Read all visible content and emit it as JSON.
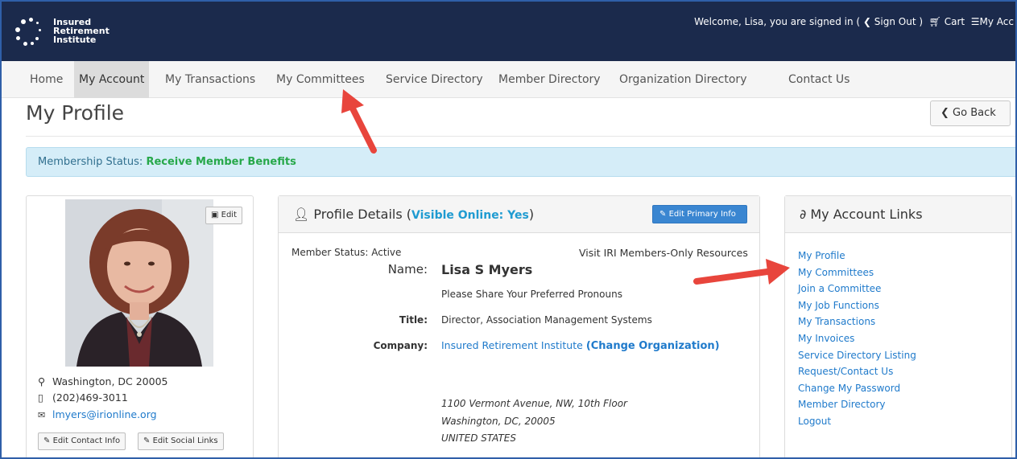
{
  "brand": {
    "logo_line1": "Insured",
    "logo_line2": "Retirement",
    "logo_line3": "Institute"
  },
  "header": {
    "welcome_text": "Welcome, Lisa, you are signed in (",
    "sign_out": "Sign Out",
    "close_paren": ")",
    "cart": "Cart",
    "my_account": "My Acc"
  },
  "nav": {
    "items": [
      {
        "label": "Home"
      },
      {
        "label": "My Account"
      },
      {
        "label": "My Transactions"
      },
      {
        "label": "My Committees"
      },
      {
        "label": "Service Directory"
      },
      {
        "label": "Member Directory"
      },
      {
        "label": "Organization Directory"
      },
      {
        "label": "Contact Us"
      }
    ],
    "active_index": 1
  },
  "page": {
    "title": "My Profile",
    "go_back": "Go Back"
  },
  "membership": {
    "label": "Membership Status:",
    "value": "Receive Member Benefits"
  },
  "photo_card": {
    "edit_label": "Edit",
    "location": "Washington, DC 20005",
    "phone": "(202)469-3011",
    "email": "lmyers@irionline.org",
    "edit_contact": "Edit Contact Info",
    "edit_social": "Edit Social Links"
  },
  "profile": {
    "header_title": "Profile Details (",
    "visible_online": "Visible Online: Yes",
    "header_close": ")",
    "edit_primary": "Edit Primary Info",
    "member_status": "Member Status: Active",
    "members_only_link": "Visit IRI Members-Only Resources",
    "name_label": "Name:",
    "name_value": "Lisa S Myers",
    "pronouns_link": "Please Share Your Preferred Pronouns",
    "title_label": "Title:",
    "title_value": "Director, Association Management Systems",
    "company_label": "Company:",
    "company_value": "Insured Retirement Institute",
    "change_org": "(Change Organization)",
    "address_line1": "1100 Vermont Avenue, NW, 10th Floor",
    "address_line2": "Washington, DC, 20005",
    "address_line3": "UNITED STATES"
  },
  "account_links": {
    "title": "My Account Links",
    "items": [
      "My Profile",
      "My Committees",
      "Join a Committee",
      "My Job Functions",
      "My Transactions",
      "My Invoices",
      "Service Directory Listing",
      "Request/Contact Us",
      "Change My Password",
      "Member Directory",
      "Logout"
    ]
  },
  "colors": {
    "topbar": "#1b2a4c",
    "link": "#1f7acb",
    "status_green": "#27a84a",
    "annotation_arrow": "#e8453c"
  }
}
